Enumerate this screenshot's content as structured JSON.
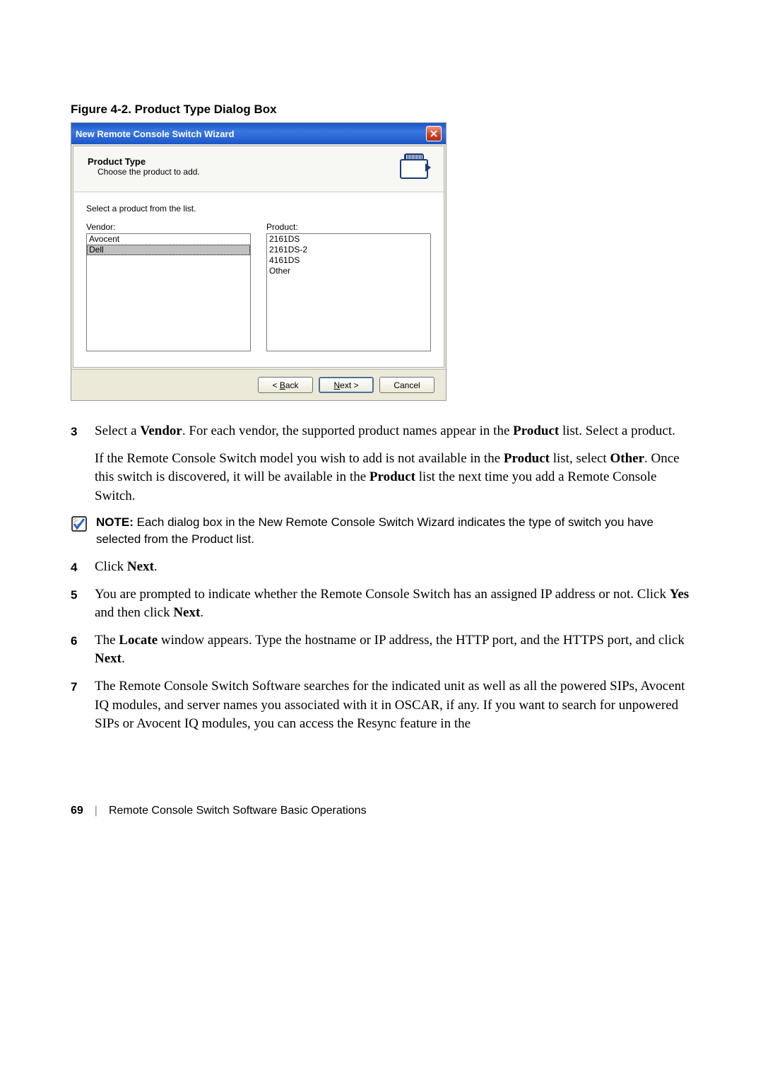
{
  "figure_caption": "Figure 4-2.    Product Type Dialog Box",
  "dialog": {
    "title": "New Remote Console Switch Wizard",
    "header_title": "Product Type",
    "header_sub": "Choose the product to add.",
    "instruction": "Select a product from the list.",
    "vendor_label": "Vendor:",
    "product_label": "Product:",
    "vendors": [
      "Avocent",
      "Dell"
    ],
    "vendor_selected_index": 1,
    "products": [
      "2161DS",
      "2161DS-2",
      "4161DS",
      "Other"
    ],
    "buttons": {
      "back_prefix": "< ",
      "back_u": "B",
      "back_suffix": "ack",
      "next_u": "N",
      "next_suffix": "ext >",
      "cancel": "Cancel"
    }
  },
  "steps": {
    "s3_num": "3",
    "s3_p1_a": "Select a ",
    "s3_p1_b": "Vendor",
    "s3_p1_c": ". For each vendor, the supported product names appear in the ",
    "s3_p1_d": "Product",
    "s3_p1_e": " list. Select a product.",
    "s3_p2_a": "If the Remote Console Switch model you wish to add is not available in the ",
    "s3_p2_b": "Product",
    "s3_p2_c": " list, select ",
    "s3_p2_d": "Other",
    "s3_p2_e": ". Once this switch is discovered, it will be available in the ",
    "s3_p2_f": "Product",
    "s3_p2_g": " list the next time you add a Remote Console Switch.",
    "s4_num": "4",
    "s4_a": "Click ",
    "s4_b": "Next",
    "s4_c": ".",
    "s5_num": "5",
    "s5_a": "You are prompted to indicate whether the Remote Console Switch has an assigned IP address or not. Click ",
    "s5_b": "Yes",
    "s5_c": " and then click ",
    "s5_d": "Next",
    "s5_e": ".",
    "s6_num": "6",
    "s6_a": "The ",
    "s6_b": "Locate",
    "s6_c": " window appears. Type the hostname or IP address, the HTTP port, and the HTTPS port, and click ",
    "s6_d": "Next",
    "s6_e": ".",
    "s7_num": "7",
    "s7_a": "The Remote Console Switch Software searches for the indicated unit as well as all the powered SIPs, Avocent IQ modules, and server names you associated with it in OSCAR, if any. If you want to search for unpowered SIPs or Avocent IQ modules, you can access the Resync feature in the"
  },
  "note": {
    "label": "NOTE:",
    "text": " Each dialog box in the New Remote Console Switch Wizard indicates the type of switch you have selected from the Product list."
  },
  "footer": {
    "page": "69",
    "title": "Remote Console Switch Software Basic Operations"
  }
}
